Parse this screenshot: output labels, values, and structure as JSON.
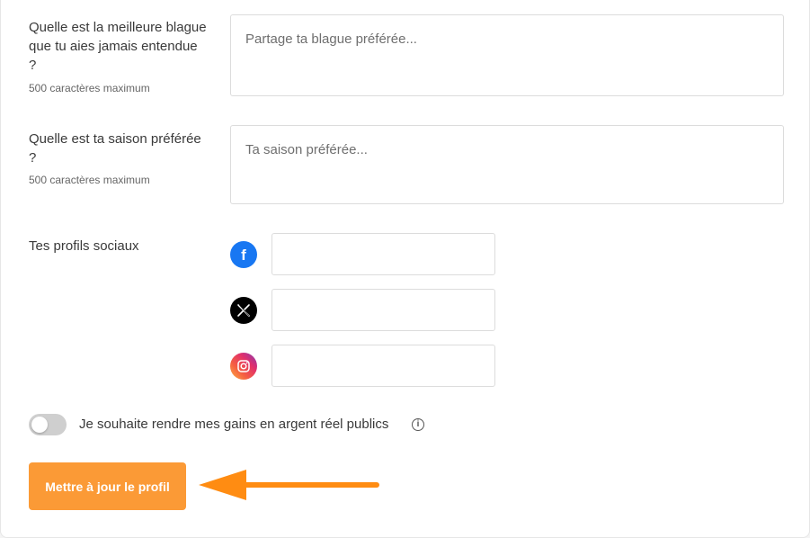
{
  "questions": [
    {
      "label": "Quelle est la meilleure blague que tu aies jamais entendue ?",
      "hint": "500 caractères maximum",
      "placeholder": "Partage ta blague préférée..."
    },
    {
      "label": "Quelle est ta saison préférée ?",
      "hint": "500 caractères maximum",
      "placeholder": "Ta saison préférée..."
    }
  ],
  "social": {
    "label": "Tes profils sociaux",
    "profiles": [
      {
        "network": "facebook",
        "icon": "facebook-icon",
        "color": "#1877f2",
        "value": ""
      },
      {
        "network": "x",
        "icon": "x-icon",
        "color": "#000000",
        "value": ""
      },
      {
        "network": "instagram",
        "icon": "instagram-icon",
        "color": "#e1306c",
        "value": ""
      }
    ]
  },
  "public_earnings": {
    "label": "Je souhaite rendre mes gains en argent réel publics",
    "enabled": false,
    "info_icon": "info-icon"
  },
  "submit": {
    "label": "Mettre à jour le profil",
    "color": "#fb9a36"
  },
  "annotation": {
    "arrow_color": "#ff8c12"
  }
}
